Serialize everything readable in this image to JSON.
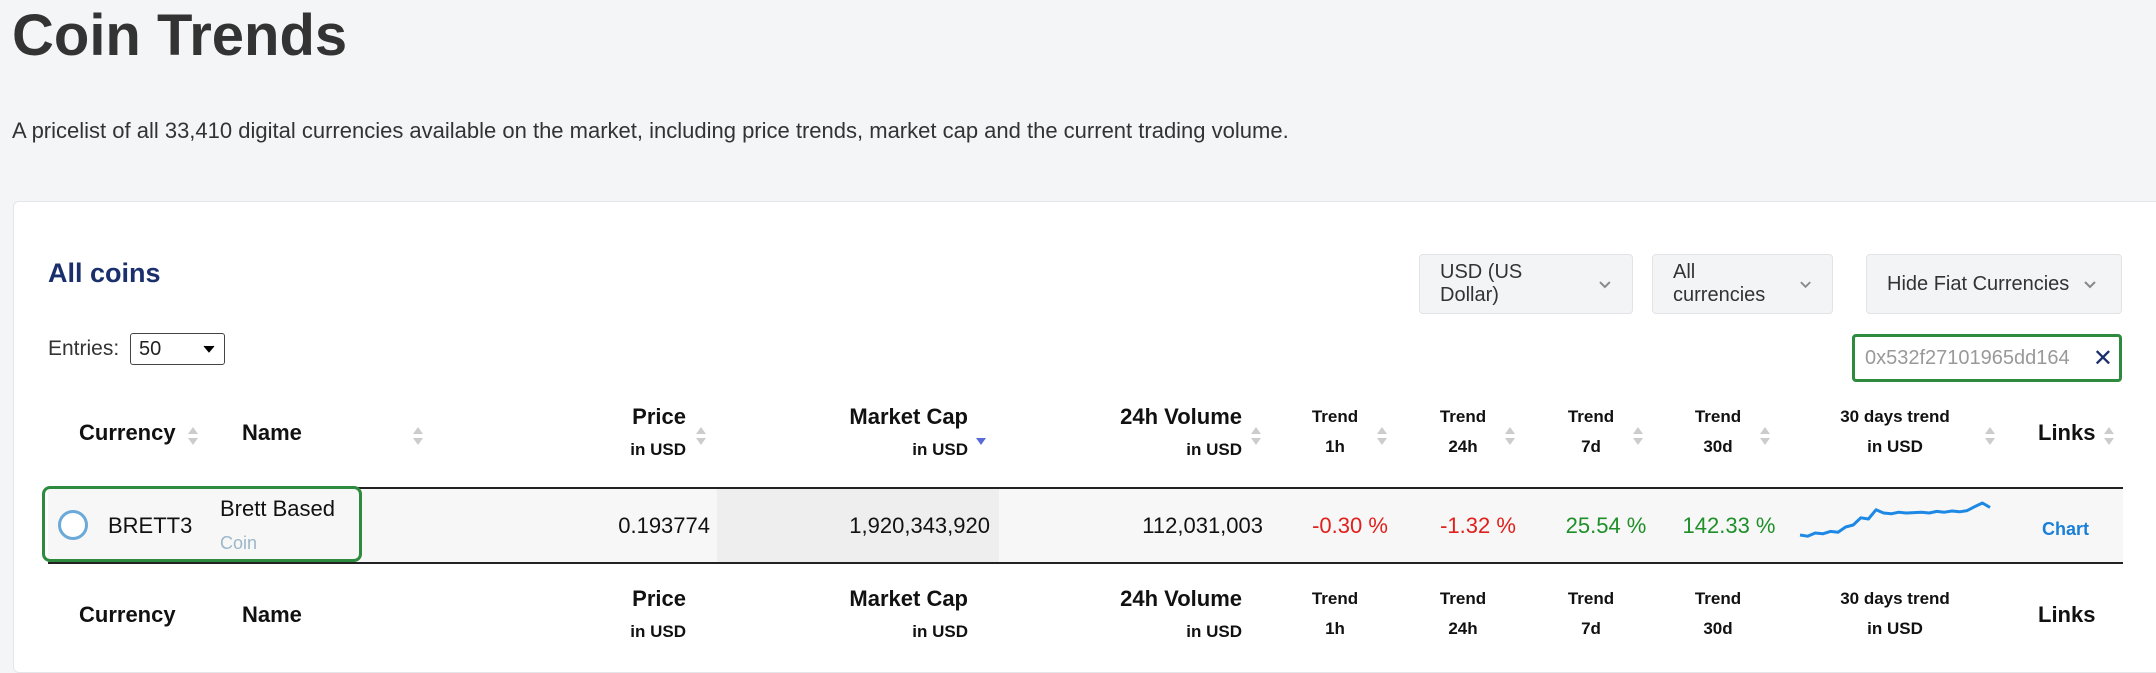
{
  "page": {
    "title": "Coin Trends",
    "description": "A pricelist of all 33,410 digital currencies available on the market, including price trends, market cap and the current trading volume."
  },
  "section": {
    "title": "All coins"
  },
  "filters": {
    "currency": "USD (US Dollar)",
    "scope": "All currencies",
    "fiat": "Hide Fiat Currencies"
  },
  "entries": {
    "label": "Entries:",
    "value": "50"
  },
  "search": {
    "value": "0x532f27101965dd164"
  },
  "columns": {
    "currency": "Currency",
    "name": "Name",
    "price": "Price",
    "price_sub": "in USD",
    "mcap": "Market Cap",
    "mcap_sub": "in USD",
    "volume": "24h Volume",
    "volume_sub": "in USD",
    "trend": "Trend",
    "t1h": "1h",
    "t24h": "24h",
    "t7d": "7d",
    "t30d": "30d",
    "spark": "30 days trend",
    "spark_sub": "in USD",
    "links": "Links"
  },
  "rows": [
    {
      "symbol": "BRETT3",
      "name": "Brett Based",
      "type": "Coin",
      "price": "0.193774",
      "market_cap": "1,920,343,920",
      "volume": "112,031,003",
      "trend_1h": "-0.30 %",
      "trend_24h": "-1.32 %",
      "trend_7d": "25.54 %",
      "trend_30d": "142.33 %",
      "link": "Chart",
      "sparkline": [
        0.15,
        0.12,
        0.2,
        0.18,
        0.24,
        0.22,
        0.35,
        0.4,
        0.58,
        0.55,
        0.78,
        0.7,
        0.68,
        0.72,
        0.7,
        0.71,
        0.72,
        0.7,
        0.74,
        0.72,
        0.75,
        0.73,
        0.76,
        0.86,
        0.95,
        0.84
      ]
    }
  ],
  "colors": {
    "accent": "#1a2f6b",
    "highlight": "#2e8b3e",
    "negative": "#e0201c",
    "positive": "#1f8f2a",
    "link": "#1a7fd6",
    "spark": "#1e88e5"
  }
}
